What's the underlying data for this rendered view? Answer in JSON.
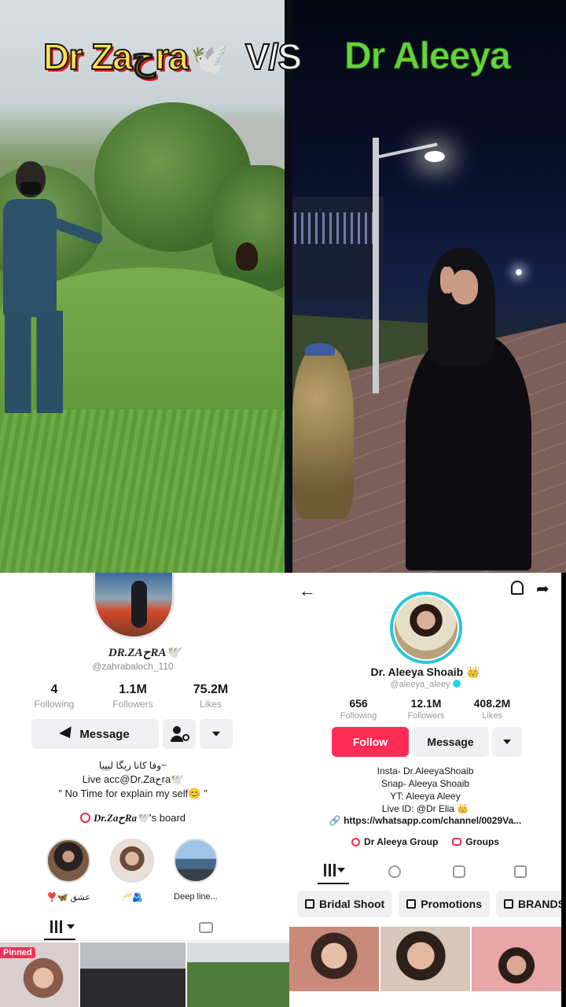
{
  "title": {
    "left": "Dr Zaحra",
    "left_icon": "🕊️",
    "vs": "V/S",
    "right": "Dr Aleeya"
  },
  "colors": {
    "follow_red": "#fe2c55",
    "verified_cyan": "#20d5ec",
    "title_yellow": "#ffe24a",
    "title_green": "#66d33d"
  },
  "left_profile": {
    "display_name": "DR.ZAحRA🕊️",
    "handle": "@zahrabaloch_110",
    "stats": [
      {
        "value": "4",
        "label": "Following"
      },
      {
        "value": "1.1M",
        "label": "Followers"
      },
      {
        "value": "75.2M",
        "label": "Likes"
      }
    ],
    "message_label": "Message",
    "bio": [
      "وفا کانا زیگا لیپیا~",
      "Live acc@Dr.Zaحra🕊️",
      "\" No Time for explain my self😊 \""
    ],
    "board_name": "Dr.ZaحRa🕊️",
    "board_suffix": "'s board",
    "highlights": [
      {
        "label": "❣️🦋 عشق"
      },
      {
        "label": "🥂🫂"
      },
      {
        "label": "Deep line..."
      }
    ],
    "pinned_label": "Pinned"
  },
  "right_profile": {
    "display_name": "Dr. Aleeya Shoaib 👑",
    "handle": "@aleeya_aleey",
    "stats": [
      {
        "value": "656",
        "label": "Following"
      },
      {
        "value": "12.1M",
        "label": "Followers"
      },
      {
        "value": "408.2M",
        "label": "Likes"
      }
    ],
    "follow_label": "Follow",
    "message_label": "Message",
    "bio": [
      "Insta- Dr.AleeyaShoaib",
      "Snap- Aleeya Shoaib",
      "YT: Aleeya Aleey",
      "Live ID: @Dr Elia 👑"
    ],
    "link": "https://whatsapp.com/channel/0029Va...",
    "group_label": "Dr Aleeya Group",
    "groups_label": "Groups",
    "collections": [
      "Bridal Shoot",
      "Promotions",
      "BRANDS CO"
    ]
  }
}
